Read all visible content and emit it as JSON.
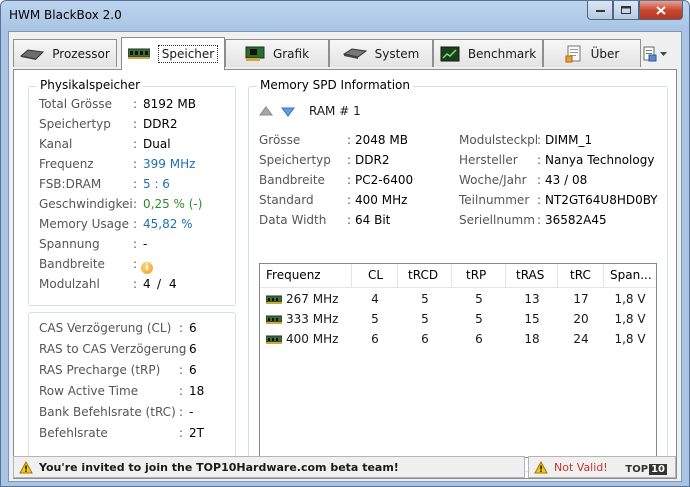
{
  "window": {
    "title": "HWM BlackBox 2.0"
  },
  "tabs": [
    {
      "id": "prozessor",
      "label": "Prozessor",
      "icon": "cpu-icon"
    },
    {
      "id": "speicher",
      "label": "Speicher",
      "icon": "ram-icon",
      "active": true
    },
    {
      "id": "grafik",
      "label": "Grafik",
      "icon": "graphics-card-icon"
    },
    {
      "id": "system",
      "label": "System",
      "icon": "drive-icon"
    },
    {
      "id": "benchmark",
      "label": "Benchmark",
      "icon": "chart-icon"
    },
    {
      "id": "ueber",
      "label": "Über",
      "icon": "info-document-icon"
    }
  ],
  "physical": {
    "title": "Physikalspeicher",
    "rows": [
      {
        "label": "Total Grösse",
        "value": "8192 MB"
      },
      {
        "label": "Speichertyp",
        "value": "DDR2"
      },
      {
        "label": "Kanal",
        "value": "Dual"
      },
      {
        "label": "Frequenz",
        "value": "399 MHz"
      },
      {
        "label": "FSB:DRAM",
        "value": "5 : 6"
      },
      {
        "label": "Geschwindigkei",
        "value": "0,25 % (-)"
      },
      {
        "label": "Memory Usage",
        "value": "45,82 %"
      },
      {
        "label": "Spannung",
        "value": "-"
      },
      {
        "label": "Bandbreite",
        "value": ""
      },
      {
        "label": "Modulzahl",
        "value": "4",
        "value2": "4"
      }
    ]
  },
  "timings": {
    "rows": [
      {
        "label": "CAS Verzögerung (CL)",
        "value": "6"
      },
      {
        "label": "RAS to CAS Verzögerung",
        "value": "6"
      },
      {
        "label": "RAS Precharge (tRP)",
        "value": "6"
      },
      {
        "label": "Row Active Time",
        "value": "18"
      },
      {
        "label": "Bank Befehlsrate (tRC)",
        "value": "-"
      },
      {
        "label": "Befehlsrate",
        "value": "2T"
      }
    ]
  },
  "spd": {
    "title": "Memory SPD Information",
    "ram_label": "RAM # 1",
    "left": [
      {
        "label": "Grösse",
        "value": "2048 MB"
      },
      {
        "label": "Speichertyp",
        "value": "DDR2"
      },
      {
        "label": "Bandbreite",
        "value": "PC2-6400"
      },
      {
        "label": "Standard",
        "value": "400 MHz"
      },
      {
        "label": "Data Width",
        "value": "64 Bit"
      }
    ],
    "right": [
      {
        "label": "Modulsteckpl",
        "value": "DIMM_1"
      },
      {
        "label": "Hersteller",
        "value": "Nanya Technology"
      },
      {
        "label": "Woche/Jahr",
        "value": "43 / 08"
      },
      {
        "label": "Teilnummer",
        "value": "NT2GT64U8HD0BY-."
      },
      {
        "label": "Seriellnumm",
        "value": "36582A45"
      }
    ],
    "table": {
      "headers": [
        "Frequenz",
        "CL",
        "tRCD",
        "tRP",
        "tRAS",
        "tRC",
        "Span..."
      ],
      "rows": [
        [
          "267 MHz",
          "4",
          "5",
          "5",
          "13",
          "17",
          "1,8 V"
        ],
        [
          "333 MHz",
          "5",
          "5",
          "5",
          "15",
          "20",
          "1,8 V"
        ],
        [
          "400 MHz",
          "6",
          "6",
          "6",
          "18",
          "24",
          "1,8 V"
        ]
      ]
    }
  },
  "status": {
    "message": "You're invited to join the TOP10Hardware.com beta team!",
    "validity": "Not Valid!",
    "logo_top": "TOP",
    "logo_ten": "10"
  },
  "colors": {
    "link_blue": "#1f6fb5",
    "green": "#2e8b2e",
    "invalid_red": "#c0392b"
  }
}
